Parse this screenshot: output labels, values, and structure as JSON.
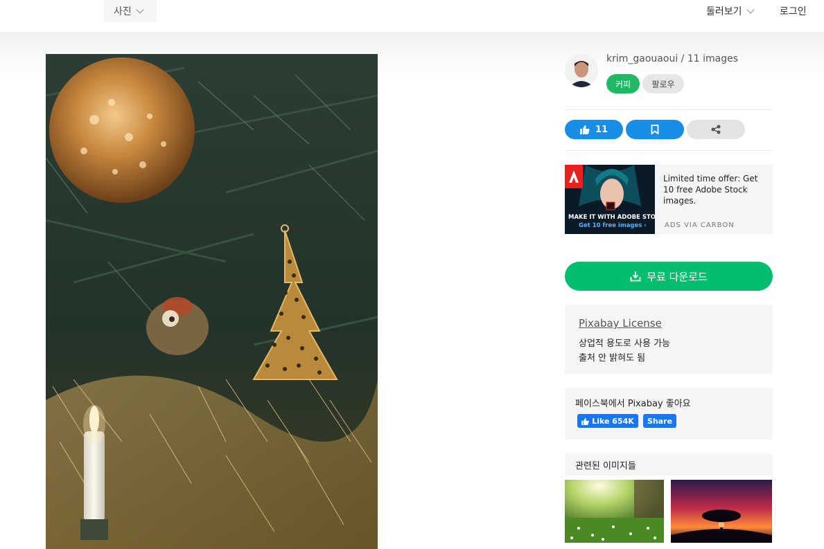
{
  "header": {
    "media_type_label": "사진",
    "explore_label": "둘러보기",
    "login_label": "로그인"
  },
  "author": {
    "line": "krim_gaouaoui / 11 images",
    "coffee_label": "커피",
    "follow_label": "팔로우"
  },
  "actions": {
    "like_count": "11"
  },
  "ad": {
    "text": "Limited time offer: Get 10 free Adobe Stock images.",
    "via": "ADS VIA CARBON",
    "image_cta_1": "MAKE IT WITH ADOBE STOCK.",
    "image_cta_2": "Get 10 free images ›",
    "brand": "Adobe",
    "product_mark": "St"
  },
  "download": {
    "label": "무료 다운로드"
  },
  "license": {
    "title": "Pixabay License",
    "line1": "상업적 용도로 사용 가능",
    "line2": "출처 안 밝혀도 됨"
  },
  "facebook": {
    "title": "페이스북에서 Pixabay 좋아요",
    "like_label": "Like 654K",
    "share_label": "Share"
  },
  "related": {
    "title": "관련된 이미지들"
  },
  "colors": {
    "green": "#02be6e",
    "blue": "#1a8ee6",
    "facebook": "#1877f2"
  }
}
